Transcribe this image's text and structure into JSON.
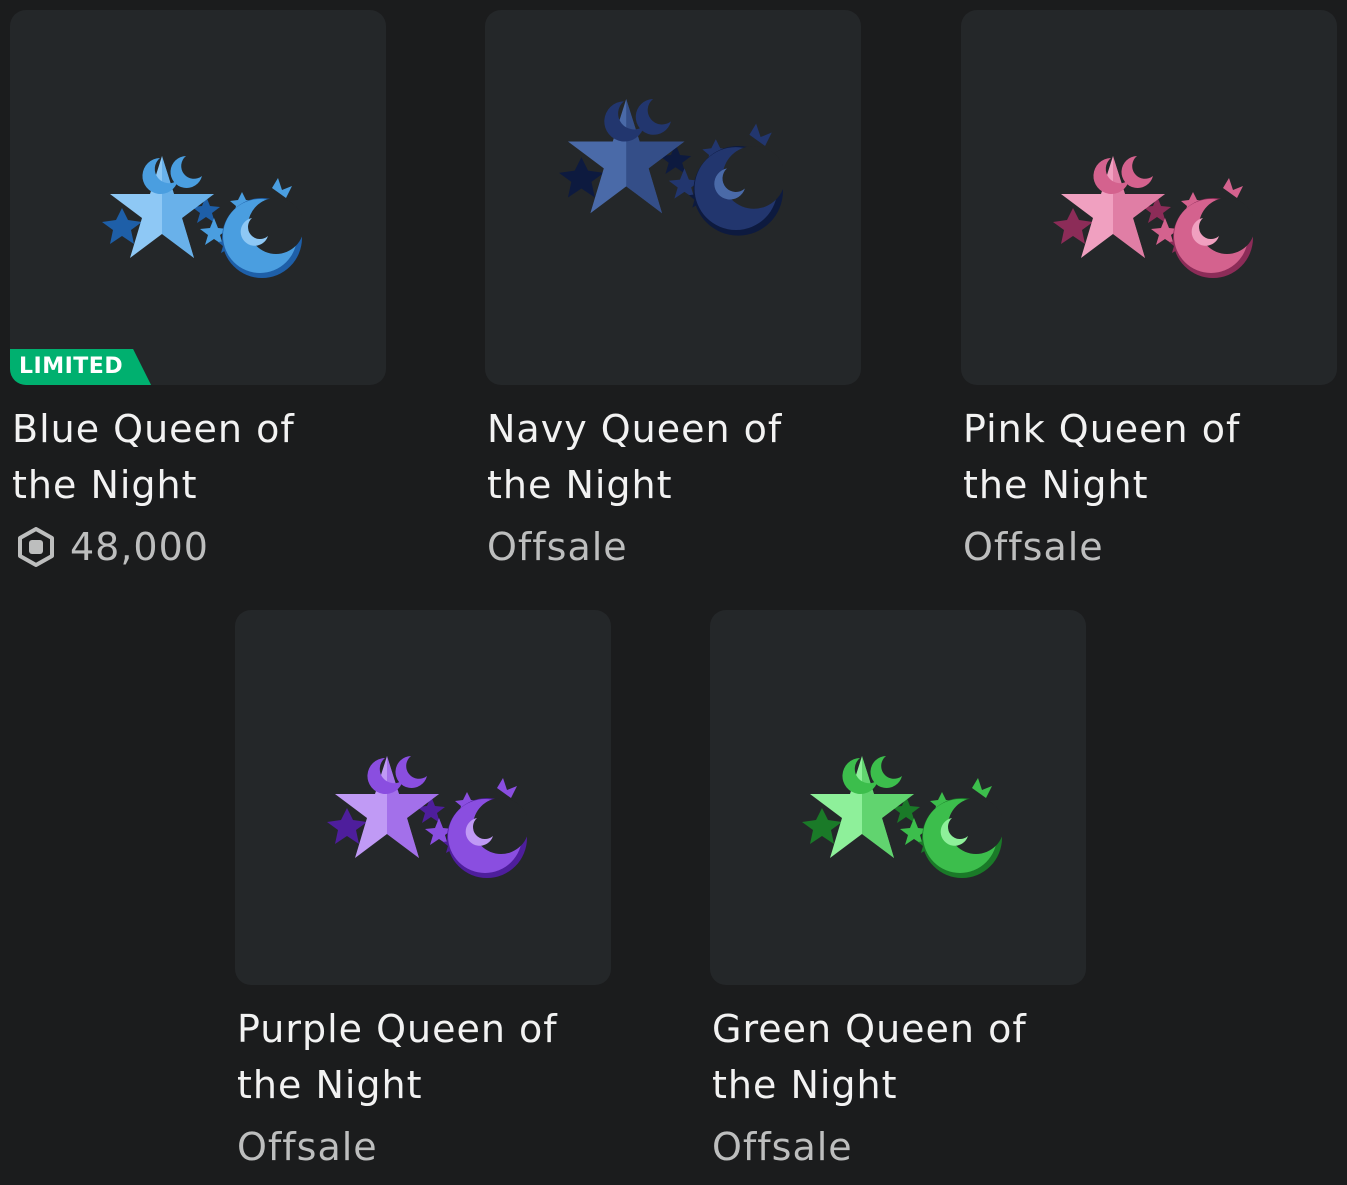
{
  "items": [
    {
      "name_line1": "Blue Queen of",
      "name_line2": "the Night",
      "price": "48,000",
      "has_robux_icon": true,
      "badge": "LIMITED",
      "colors": {
        "light": "#8ec8f5",
        "mid": "#4a9ee0",
        "dark": "#1e5fa8"
      }
    },
    {
      "name_line1": "Navy Queen of",
      "name_line2": "the Night",
      "price": "Offsale",
      "has_robux_icon": false,
      "badge": "",
      "colors": {
        "light": "#4a6aa8",
        "mid": "#22366e",
        "dark": "#0d1a3f"
      }
    },
    {
      "name_line1": "Pink Queen of",
      "name_line2": "the Night",
      "price": "Offsale",
      "has_robux_icon": false,
      "badge": "",
      "colors": {
        "light": "#f0a0c0",
        "mid": "#d4628e",
        "dark": "#8c2c58"
      }
    },
    {
      "name_line1": "Purple Queen of",
      "name_line2": "the Night",
      "price": "Offsale",
      "has_robux_icon": false,
      "badge": "",
      "colors": {
        "light": "#c09af5",
        "mid": "#8a4ee0",
        "dark": "#4e1e9c"
      }
    },
    {
      "name_line1": "Green Queen of",
      "name_line2": "the Night",
      "price": "Offsale",
      "has_robux_icon": false,
      "badge": "",
      "colors": {
        "light": "#8ef09a",
        "mid": "#3cbe4c",
        "dark": "#1a7a28"
      }
    }
  ]
}
